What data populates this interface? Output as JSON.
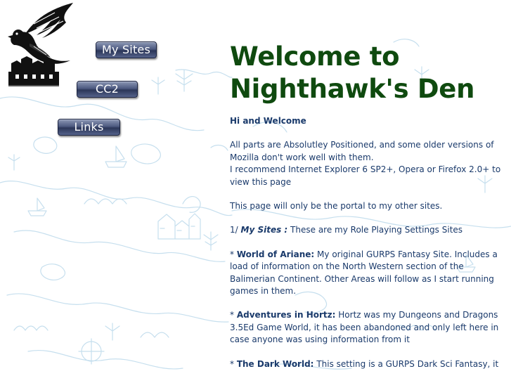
{
  "nav": {
    "my_sites": "My Sites",
    "cc2": "CC2",
    "links": "Links"
  },
  "main": {
    "title_line1": "Welcome to",
    "title_line2": "Nighthawk's Den",
    "greeting": "Hi and Welcome",
    "positioning_note": "All parts are Absolutley Positioned, and some older versions of Mozilla don't work well with them.",
    "browser_note": "I recommend Internet Explorer 6 SP2+, Opera or Firefox 2.0+ to view this page",
    "portal_note": "This page will only be the portal to my other sites.",
    "section_number": "1/",
    "section_name": "My Sites :",
    "section_desc": "These are my Role Playing Settings Sites",
    "sites": [
      {
        "bullet": "*",
        "name": "World of Ariane:",
        "desc": "My original GURPS Fantasy Site. Includes a load of information on the North Western section of the Balimerian Continent. Other Areas will follow as I start running games in them."
      },
      {
        "bullet": "*",
        "name": "Adventures in Hortz:",
        "desc": "Hortz was my Dungeons and Dragons 3.5Ed Game World, it has been abandoned and only left here in case anyone was using information from it"
      },
      {
        "bullet": "*",
        "name": "The Dark World:",
        "desc": "This setting is a GURPS Dark Sci Fantasy, it"
      }
    ]
  },
  "colors": {
    "title": "#0f4a0f",
    "body_text": "#1a3a6b",
    "map_lines": "#c6dfee",
    "button": "#3c4870"
  },
  "icons": {
    "logo": "nighthawk-bird-logo",
    "background": "fantasy-map-watermark"
  }
}
